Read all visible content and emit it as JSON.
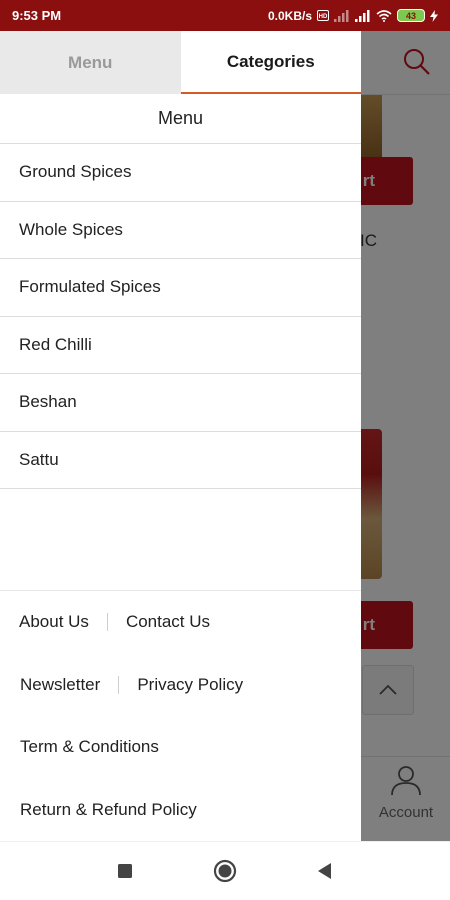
{
  "status_bar": {
    "time": "9:53 PM",
    "network_speed": "0.0KB/s",
    "battery_level": "43"
  },
  "background_app": {
    "add_to_cart_fragment": "rt",
    "product_text_fragment": "IC",
    "bottom_nav": {
      "account_label": "Account"
    }
  },
  "drawer": {
    "tabs": [
      {
        "label": "Menu",
        "active": false
      },
      {
        "label": "Categories",
        "active": true
      }
    ],
    "menu_heading": "Menu",
    "categories": [
      "Ground Spices",
      "Whole Spices",
      "Formulated Spices",
      "Red Chilli",
      "Beshan",
      "Sattu"
    ],
    "footer_links": {
      "about": "About Us",
      "contact": "Contact Us",
      "newsletter": "Newsletter",
      "privacy": "Privacy Policy",
      "terms": "Term & Conditions",
      "refund": "Return & Refund Policy"
    }
  },
  "colors": {
    "status_bar": "#8b0f0f",
    "accent": "#c1121f",
    "tab_underline": "#d45a2a"
  }
}
